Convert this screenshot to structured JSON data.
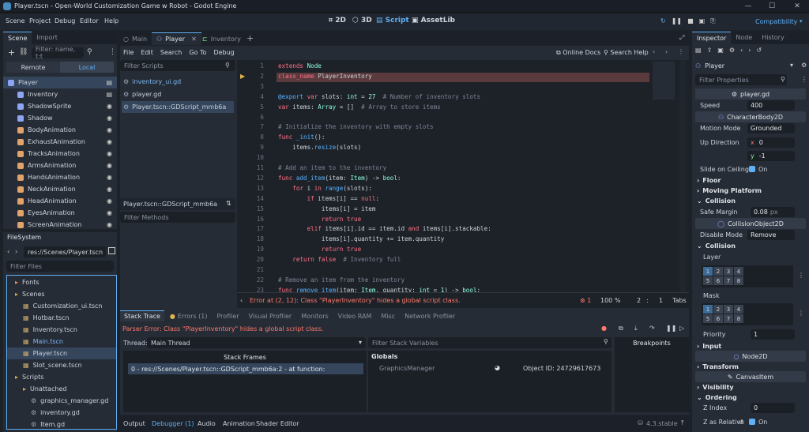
{
  "window": {
    "title": "Player.tscn - Open-World Customization Game w Robot - Godot Engine"
  },
  "menubar": {
    "items": [
      "Scene",
      "Project",
      "Debug",
      "Editor",
      "Help"
    ],
    "workspaces": [
      "2D",
      "3D",
      "Script",
      "AssetLib"
    ],
    "active_workspace": "Script",
    "renderer": "Compatibility"
  },
  "scene_dock": {
    "tabs": [
      "Scene",
      "Import"
    ],
    "filter_placeholder": "Filter: name, t:t",
    "remote_label": "Remote",
    "local_label": "Local",
    "nodes": [
      "Player",
      "Inventory",
      "ShadowSprite",
      "Shadow",
      "BodyAnimation",
      "ExhaustAnimation",
      "TracksAnimation",
      "ArmsAnimation",
      "HandsAnimation",
      "NeckAnimation",
      "HeadAnimation",
      "EyesAnimation",
      "ScreenAnimation"
    ]
  },
  "filesystem": {
    "title": "FileSystem",
    "path": "res://Scenes/Player.tscn",
    "filter_placeholder": "Filter Files",
    "items": [
      {
        "name": "Fonts",
        "type": "folder",
        "indent": 1
      },
      {
        "name": "Scenes",
        "type": "folder",
        "indent": 1
      },
      {
        "name": "Customization_ui.tscn",
        "type": "scene",
        "indent": 2
      },
      {
        "name": "Hotbar.tscn",
        "type": "scene",
        "indent": 2
      },
      {
        "name": "Inventory.tscn",
        "type": "scene",
        "indent": 2
      },
      {
        "name": "Main.tscn",
        "type": "scene",
        "indent": 2
      },
      {
        "name": "Player.tscn",
        "type": "scene",
        "indent": 2
      },
      {
        "name": "Slot_scene.tscn",
        "type": "scene",
        "indent": 2
      },
      {
        "name": "Scripts",
        "type": "folder",
        "indent": 1
      },
      {
        "name": "Unattached",
        "type": "folder",
        "indent": 2
      },
      {
        "name": "graphics_manager.gd",
        "type": "script",
        "indent": 3
      },
      {
        "name": "inventory.gd",
        "type": "script",
        "indent": 3
      },
      {
        "name": "Item.gd",
        "type": "script",
        "indent": 3
      }
    ]
  },
  "editor_tabs": [
    "Main",
    "Player",
    "Inventory"
  ],
  "script_menu": [
    "File",
    "Edit",
    "Search",
    "Go To",
    "Debug"
  ],
  "script_links": [
    "Online Docs",
    "Search Help"
  ],
  "script_list": {
    "filter_placeholder": "Filter Scripts",
    "items": [
      "inventory_ui.gd",
      "player.gd",
      "Player.tscn::GDScript_mmb6a"
    ],
    "current": "Player.tscn::GDScript_mmb6a",
    "methods_placeholder": "Filter Methods"
  },
  "code_lines": [
    "extends Node",
    "class_name PlayerInventory",
    "",
    "@export var slots: int = 27  # Number of inventory slots",
    "var items: Array = []  # Array to store items",
    "",
    "# Initialize the inventory with empty slots",
    "func _init():",
    "    items.resize(slots)",
    "",
    "# Add an item to the inventory",
    "func add_item(item: Item) -> bool:",
    "    for i in range(slots):",
    "        if items[i] == null:",
    "            items[i] = item",
    "            return true",
    "        elif items[i].id == item.id and items[i].stackable:",
    "            items[i].quantity += item.quantity",
    "            return true",
    "    return false  # Inventory full",
    "",
    "# Remove an item from the inventory",
    "func remove_item(item: Item, quantity: int = 1) -> bool:"
  ],
  "status": {
    "error": "Error at (2, 12): Class \"PlayerInventory\" hides a global script class.",
    "error_count": "1",
    "zoom": "100 %",
    "line": "2",
    "col": "1",
    "indent": "Tabs"
  },
  "debugger": {
    "tabs": [
      "Stack Trace",
      "Errors (1)",
      "Profiler",
      "Visual Profiler",
      "Monitors",
      "Video RAM",
      "Misc",
      "Network Profiler"
    ],
    "message": "Parser Error: Class \"PlayerInventory\" hides a global script class.",
    "thread_label": "Thread:",
    "thread_value": "Main Thread",
    "stack_frames_title": "Stack Frames",
    "frame": "0 - res://Scenes/Player.tscn::GDScript_mmb6a:2 - at function:",
    "filter_vars_placeholder": "Filter Stack Variables",
    "globals_label": "Globals",
    "var_name": "GraphicsManager",
    "var_value": "Object ID: 24729617673",
    "breakpoints_label": "Breakpoints"
  },
  "bottom_bar": {
    "tabs": [
      "Output",
      "Debugger (1)",
      "Audio",
      "Animation",
      "Shader Editor"
    ],
    "version": "4.3.stable"
  },
  "inspector": {
    "tabs": [
      "Inspector",
      "Node",
      "History"
    ],
    "node": "Player",
    "filter_placeholder": "Filter Properties",
    "script": "player.gd",
    "speed_label": "Speed",
    "speed_value": "400",
    "class1": "CharacterBody2D",
    "motion_mode_label": "Motion Mode",
    "motion_mode_value": "Grounded",
    "up_dir_label": "Up Direction",
    "up_x": "0",
    "up_y": "-1",
    "slide_label": "Slide on Ceiling",
    "slide_value": "On",
    "floor": "Floor",
    "moving_platform": "Moving Platform",
    "collision": "Collision",
    "safe_margin_label": "Safe Margin",
    "safe_margin_value": "0.08",
    "safe_margin_unit": "px",
    "class2": "CollisionObject2D",
    "disable_mode_label": "Disable Mode",
    "disable_mode_value": "Remove",
    "collision2": "Collision",
    "layer_label": "Layer",
    "mask_label": "Mask",
    "priority_label": "Priority",
    "priority_value": "1",
    "input": "Input",
    "class3": "Node2D",
    "transform": "Transform",
    "class4": "CanvasItem",
    "visibility": "Visibility",
    "ordering": "Ordering",
    "z_index_label": "Z Index",
    "z_index_value": "0",
    "z_relative_label": "Z as Relative",
    "z_relative_value": "On"
  },
  "colors": {
    "accent": "#5fb0f5",
    "error": "#ff786b",
    "bg": "#1d2229"
  }
}
